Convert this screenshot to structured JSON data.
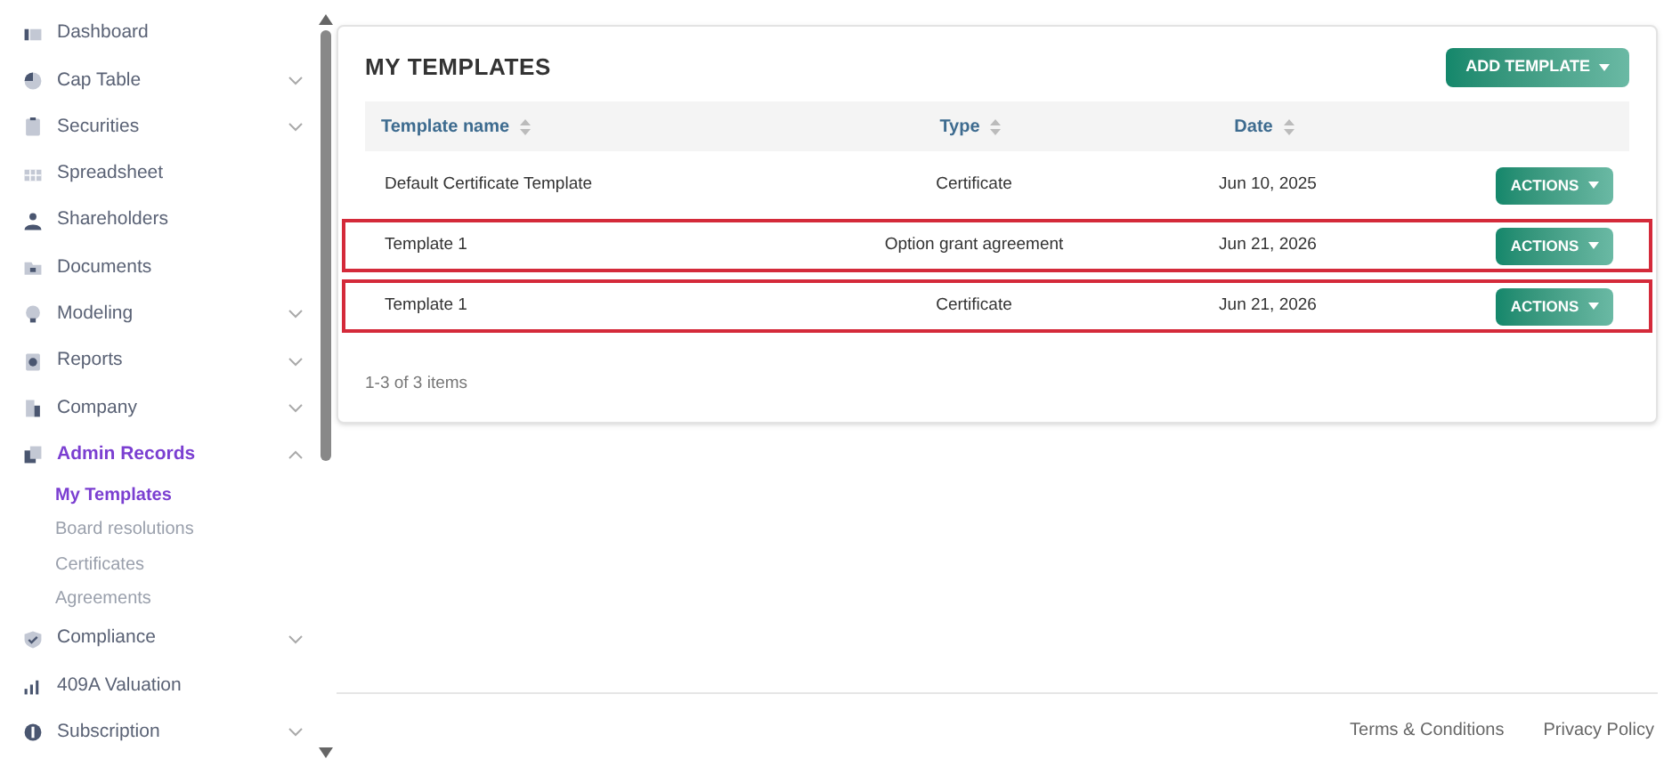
{
  "sidebar": {
    "items": [
      {
        "label": "Dashboard",
        "selected": false
      },
      {
        "label": "Cap Table",
        "selected": false,
        "expanded": false
      },
      {
        "label": "Securities",
        "selected": false,
        "expanded": false
      },
      {
        "label": "Spreadsheet",
        "selected": false
      },
      {
        "label": "Shareholders",
        "selected": false
      },
      {
        "label": "Documents",
        "selected": false
      },
      {
        "label": "Modeling",
        "selected": false,
        "expanded": false
      },
      {
        "label": "Reports",
        "selected": false,
        "expanded": false
      },
      {
        "label": "Company",
        "selected": false,
        "expanded": false
      },
      {
        "label": "Admin Records",
        "selected": true,
        "expanded": true,
        "children": [
          {
            "label": "My Templates",
            "selected": true
          },
          {
            "label": "Board resolutions",
            "selected": false
          },
          {
            "label": "Certificates",
            "selected": false
          },
          {
            "label": "Agreements",
            "selected": false
          }
        ]
      },
      {
        "label": "Compliance",
        "selected": false,
        "expanded": false
      },
      {
        "label": "409A Valuation",
        "selected": false
      },
      {
        "label": "Subscription",
        "selected": false,
        "expanded": false
      }
    ]
  },
  "card": {
    "title": "MY TEMPLATES",
    "add_button": "ADD TEMPLATE",
    "table": {
      "columns": [
        "Template name",
        "Type",
        "Date"
      ],
      "rows": [
        {
          "cells": [
            "Default Certificate Template",
            "Certificate",
            "Jun 10, 2025"
          ],
          "action": "ACTIONS",
          "highlighted": false
        },
        {
          "cells": [
            "Template 1",
            "Option grant agreement",
            "Jun 21, 2026"
          ],
          "action": "ACTIONS",
          "highlighted": true
        },
        {
          "cells": [
            "Template 1",
            "Certificate",
            "Jun 21, 2026"
          ],
          "action": "ACTIONS",
          "highlighted": true
        }
      ]
    },
    "pagination": "1-3 of 3 items"
  },
  "footer": {
    "links": [
      "Terms & Conditions",
      "Privacy Policy"
    ]
  }
}
